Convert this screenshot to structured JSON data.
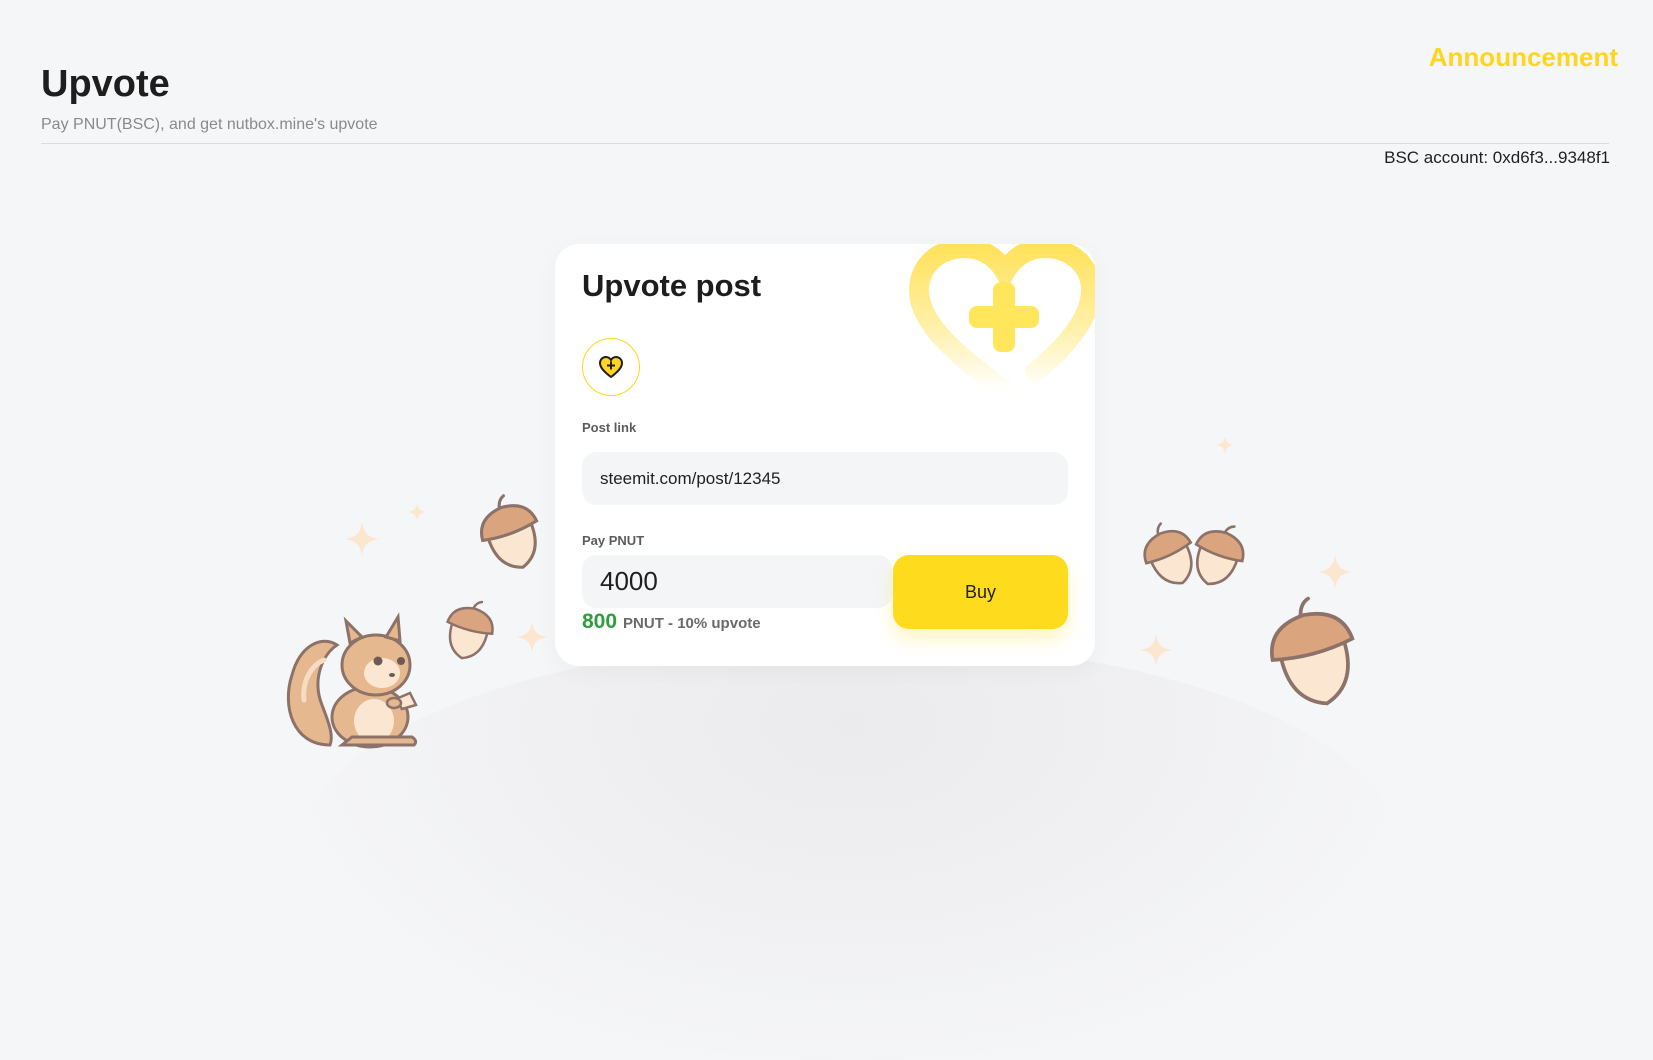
{
  "header": {
    "title": "Upvote",
    "subtitle": "Pay PNUT(BSC), and get nutbox.mine's upvote",
    "announcement_label": "Announcement",
    "account_text": "BSC account: 0xd6f3...9348f1"
  },
  "card": {
    "title": "Upvote post",
    "icon": "heart-plus-icon",
    "post_link": {
      "label": "Post link",
      "value": "steemit.com/post/12345"
    },
    "pay": {
      "label": "Pay PNUT",
      "value": "4000",
      "upvote_amount": "800",
      "upvote_text": "PNUT - 10% upvote"
    },
    "buy_label": "Buy"
  },
  "colors": {
    "accent": "#ffd51f",
    "button": "#ffdb1e",
    "amount_green": "#2f9e3f",
    "background": "#f5f6f8"
  },
  "decorations": [
    "squirrel-illustration",
    "acorn-icon",
    "sparkle-icon"
  ]
}
